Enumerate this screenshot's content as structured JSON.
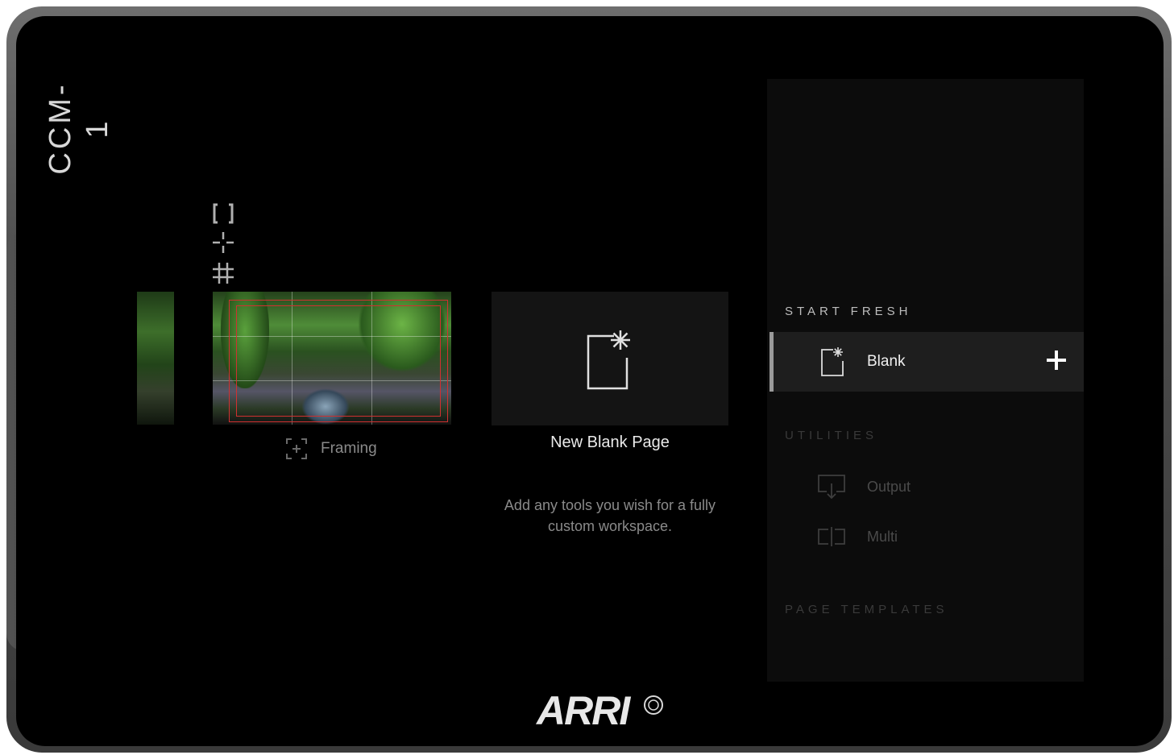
{
  "device": {
    "model": "CCM-1",
    "brand": "ARRI"
  },
  "overlay_tools": [
    {
      "icon": "frame-lines-icon",
      "glyph": "[ ]"
    },
    {
      "icon": "center-mark-icon",
      "glyph": "-¦-"
    },
    {
      "icon": "grid-icon",
      "glyph": "#"
    }
  ],
  "pages": [
    {
      "name": "Framing",
      "icon": "framing-icon"
    }
  ],
  "blank_card": {
    "title": "New Blank Page",
    "description": "Add any tools you wish for a fully custom workspace."
  },
  "panel": {
    "start_fresh": {
      "heading": "START FRESH",
      "items": [
        {
          "label": "Blank",
          "icon": "new-page-icon",
          "action_glyph": "+"
        }
      ]
    },
    "utilities": {
      "heading": "UTILITIES",
      "items": [
        {
          "label": "Output",
          "icon": "output-icon"
        },
        {
          "label": "Multi",
          "icon": "multi-icon"
        }
      ]
    },
    "page_templates": {
      "heading": "PAGE TEMPLATES"
    }
  },
  "colors": {
    "background": "#000000",
    "panel": "#0c0c0c",
    "selected": "#1e1e1e",
    "frame_lines": "#d03030",
    "dim_text": "#4a4a4a"
  }
}
